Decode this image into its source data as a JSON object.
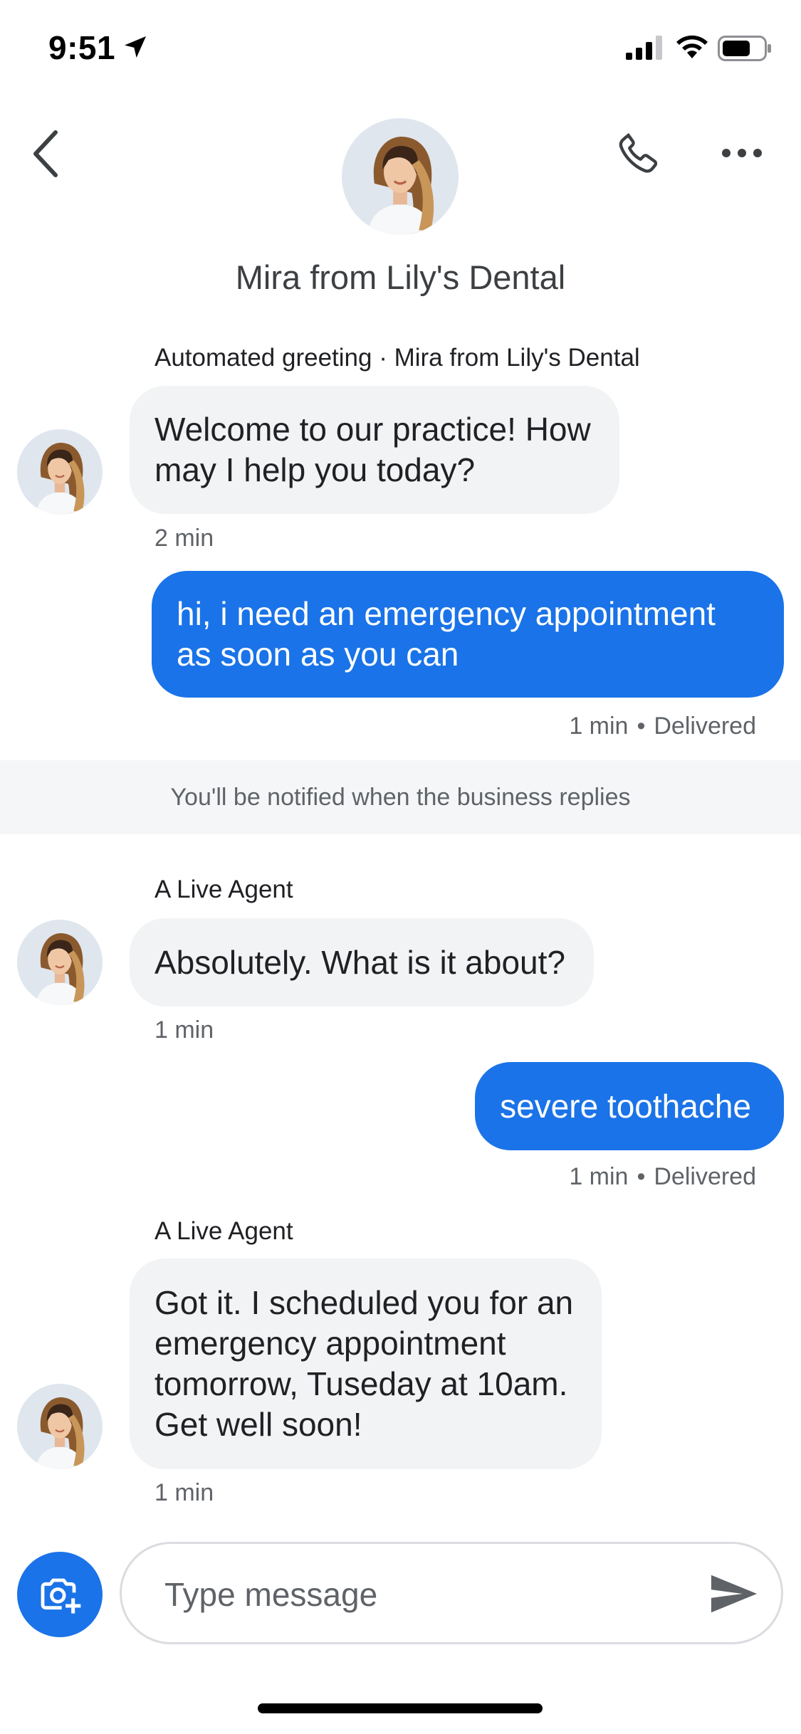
{
  "status_bar": {
    "time": "9:51",
    "icons": [
      "location-arrow-icon",
      "cellular-signal-icon",
      "wifi-icon",
      "battery-icon"
    ]
  },
  "header": {
    "title": "Mira from Lily's Dental",
    "icons": [
      "back-chevron-icon",
      "phone-icon",
      "more-options-icon"
    ]
  },
  "messages": [
    {
      "direction": "incoming",
      "sender": "Automated greeting · Mira from Lily's Dental",
      "lines": [
        "Welcome to our practice! How",
        "may I help you today?"
      ],
      "time": "2 min"
    },
    {
      "direction": "outgoing",
      "lines": [
        "hi, i need an emergency appointment",
        "as soon as you can"
      ],
      "time": "1 min",
      "status": "Delivered"
    },
    {
      "direction": "system",
      "text": "You'll be notified when the business replies"
    },
    {
      "direction": "incoming",
      "sender": "A Live Agent",
      "lines": [
        "Absolutely. What is it about?"
      ],
      "time": "1 min"
    },
    {
      "direction": "outgoing",
      "lines": [
        "severe toothache"
      ],
      "time": "1 min",
      "status": "Delivered"
    },
    {
      "direction": "incoming",
      "sender": "A Live Agent",
      "lines": [
        "Got it. I scheduled you for an",
        "emergency appointment",
        "tomorrow, Tuseday at 10am.",
        "Get well soon!"
      ],
      "time": "1 min"
    }
  ],
  "composer": {
    "placeholder": "Type message",
    "value": "",
    "icons": [
      "add-photo-camera-icon",
      "send-icon"
    ]
  },
  "colors": {
    "accent": "#1a73e8",
    "incoming_bubble": "#f1f3f4",
    "secondary_text": "#5f6368"
  }
}
